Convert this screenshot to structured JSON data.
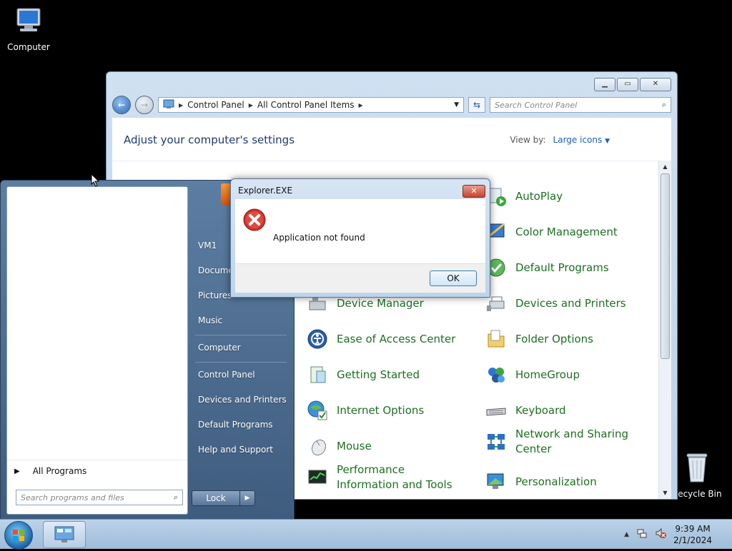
{
  "desktop": {
    "icons": [
      {
        "label": "Computer",
        "icon": "computer-icon"
      },
      {
        "label": "Recycle Bin",
        "icon": "recycle-bin-icon"
      }
    ]
  },
  "control_panel": {
    "breadcrumb": [
      "Control Panel",
      "All Control Panel Items"
    ],
    "search_placeholder": "Search Control Panel",
    "heading": "Adjust your computer's settings",
    "view_by_label": "View by:",
    "view_by_value": "Large icons",
    "items": [
      {
        "label": "AutoPlay",
        "icon": "autoplay-icon"
      },
      {
        "label": "Color Management",
        "icon": "color-management-icon"
      },
      {
        "label": "Default Programs",
        "icon": "default-programs-icon"
      },
      {
        "label": "Device Manager",
        "icon": "device-manager-icon"
      },
      {
        "label": "Devices and Printers",
        "icon": "devices-printers-icon"
      },
      {
        "label": "Ease of Access Center",
        "icon": "ease-of-access-icon"
      },
      {
        "label": "Folder Options",
        "icon": "folder-options-icon"
      },
      {
        "label": "Getting Started",
        "icon": "getting-started-icon"
      },
      {
        "label": "HomeGroup",
        "icon": "homegroup-icon"
      },
      {
        "label": "Internet Options",
        "icon": "internet-options-icon"
      },
      {
        "label": "Keyboard",
        "icon": "keyboard-icon"
      },
      {
        "label": "Mouse",
        "icon": "mouse-icon"
      },
      {
        "label": "Network and Sharing Center",
        "icon": "network-sharing-icon"
      },
      {
        "label": "Performance Information and Tools",
        "icon": "performance-icon"
      },
      {
        "label": "Personalization",
        "icon": "personalization-icon"
      }
    ]
  },
  "start_menu": {
    "right_items": [
      "VM1",
      "Docume",
      "Pictures",
      "Music",
      "Computer",
      "Control Panel",
      "Devices and Printers",
      "Default Programs",
      "Help and Support"
    ],
    "all_programs": "All Programs",
    "search_placeholder": "Search programs and files",
    "lock_label": "Lock"
  },
  "dialog": {
    "title": "Explorer.EXE",
    "message": "Application not found",
    "ok_label": "OK",
    "close_glyph": "✕"
  },
  "taskbar": {
    "time": "9:39 AM",
    "date": "2/1/2024"
  },
  "colors": {
    "cp_item_text": "#1e6f22",
    "heading": "#1e3a6e",
    "accent": "#1e5fb4"
  }
}
